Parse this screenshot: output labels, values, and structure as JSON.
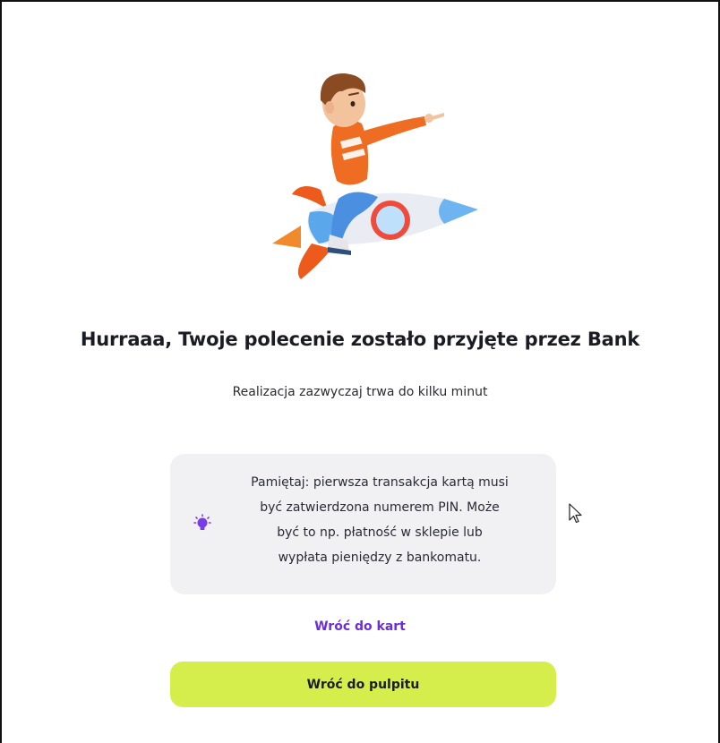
{
  "confirmation": {
    "illustration": "boy-riding-rocket",
    "title": "Hurraaa, Twoje polecenie zostało przyjęte przez Bank",
    "subtitle": "Realizacja zazwyczaj trwa do kilku minut"
  },
  "info_box": {
    "icon": "lightbulb-icon",
    "line1": "Pamiętaj: pierwsza transakcja kartą musi",
    "line2": "być zatwierdzona numerem PIN. Może",
    "line3": "być to np. płatność w sklepie lub",
    "line4": "wypłata pieniędzy z bankomatu."
  },
  "actions": {
    "back_to_cards": "Wróć do kart",
    "back_to_dashboard": "Wróć do pulpitu"
  },
  "colors": {
    "accent_purple": "#6a2fd8",
    "button_lime": "#d6ee4c",
    "info_bg": "#f1f1f4"
  }
}
